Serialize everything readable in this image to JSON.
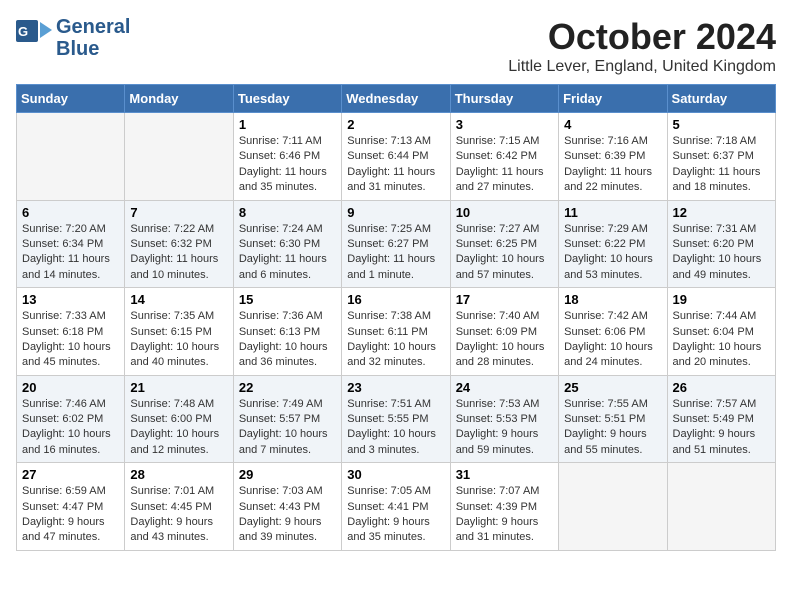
{
  "logo": {
    "line1": "General",
    "line2": "Blue"
  },
  "title": "October 2024",
  "location": "Little Lever, England, United Kingdom",
  "days_of_week": [
    "Sunday",
    "Monday",
    "Tuesday",
    "Wednesday",
    "Thursday",
    "Friday",
    "Saturday"
  ],
  "weeks": [
    [
      {
        "day": "",
        "info": ""
      },
      {
        "day": "",
        "info": ""
      },
      {
        "day": "1",
        "sunrise": "7:11 AM",
        "sunset": "6:46 PM",
        "daylight": "11 hours and 35 minutes."
      },
      {
        "day": "2",
        "sunrise": "7:13 AM",
        "sunset": "6:44 PM",
        "daylight": "11 hours and 31 minutes."
      },
      {
        "day": "3",
        "sunrise": "7:15 AM",
        "sunset": "6:42 PM",
        "daylight": "11 hours and 27 minutes."
      },
      {
        "day": "4",
        "sunrise": "7:16 AM",
        "sunset": "6:39 PM",
        "daylight": "11 hours and 22 minutes."
      },
      {
        "day": "5",
        "sunrise": "7:18 AM",
        "sunset": "6:37 PM",
        "daylight": "11 hours and 18 minutes."
      }
    ],
    [
      {
        "day": "6",
        "sunrise": "7:20 AM",
        "sunset": "6:34 PM",
        "daylight": "11 hours and 14 minutes."
      },
      {
        "day": "7",
        "sunrise": "7:22 AM",
        "sunset": "6:32 PM",
        "daylight": "11 hours and 10 minutes."
      },
      {
        "day": "8",
        "sunrise": "7:24 AM",
        "sunset": "6:30 PM",
        "daylight": "11 hours and 6 minutes."
      },
      {
        "day": "9",
        "sunrise": "7:25 AM",
        "sunset": "6:27 PM",
        "daylight": "11 hours and 1 minute."
      },
      {
        "day": "10",
        "sunrise": "7:27 AM",
        "sunset": "6:25 PM",
        "daylight": "10 hours and 57 minutes."
      },
      {
        "day": "11",
        "sunrise": "7:29 AM",
        "sunset": "6:22 PM",
        "daylight": "10 hours and 53 minutes."
      },
      {
        "day": "12",
        "sunrise": "7:31 AM",
        "sunset": "6:20 PM",
        "daylight": "10 hours and 49 minutes."
      }
    ],
    [
      {
        "day": "13",
        "sunrise": "7:33 AM",
        "sunset": "6:18 PM",
        "daylight": "10 hours and 45 minutes."
      },
      {
        "day": "14",
        "sunrise": "7:35 AM",
        "sunset": "6:15 PM",
        "daylight": "10 hours and 40 minutes."
      },
      {
        "day": "15",
        "sunrise": "7:36 AM",
        "sunset": "6:13 PM",
        "daylight": "10 hours and 36 minutes."
      },
      {
        "day": "16",
        "sunrise": "7:38 AM",
        "sunset": "6:11 PM",
        "daylight": "10 hours and 32 minutes."
      },
      {
        "day": "17",
        "sunrise": "7:40 AM",
        "sunset": "6:09 PM",
        "daylight": "10 hours and 28 minutes."
      },
      {
        "day": "18",
        "sunrise": "7:42 AM",
        "sunset": "6:06 PM",
        "daylight": "10 hours and 24 minutes."
      },
      {
        "day": "19",
        "sunrise": "7:44 AM",
        "sunset": "6:04 PM",
        "daylight": "10 hours and 20 minutes."
      }
    ],
    [
      {
        "day": "20",
        "sunrise": "7:46 AM",
        "sunset": "6:02 PM",
        "daylight": "10 hours and 16 minutes."
      },
      {
        "day": "21",
        "sunrise": "7:48 AM",
        "sunset": "6:00 PM",
        "daylight": "10 hours and 12 minutes."
      },
      {
        "day": "22",
        "sunrise": "7:49 AM",
        "sunset": "5:57 PM",
        "daylight": "10 hours and 7 minutes."
      },
      {
        "day": "23",
        "sunrise": "7:51 AM",
        "sunset": "5:55 PM",
        "daylight": "10 hours and 3 minutes."
      },
      {
        "day": "24",
        "sunrise": "7:53 AM",
        "sunset": "5:53 PM",
        "daylight": "9 hours and 59 minutes."
      },
      {
        "day": "25",
        "sunrise": "7:55 AM",
        "sunset": "5:51 PM",
        "daylight": "9 hours and 55 minutes."
      },
      {
        "day": "26",
        "sunrise": "7:57 AM",
        "sunset": "5:49 PM",
        "daylight": "9 hours and 51 minutes."
      }
    ],
    [
      {
        "day": "27",
        "sunrise": "6:59 AM",
        "sunset": "4:47 PM",
        "daylight": "9 hours and 47 minutes."
      },
      {
        "day": "28",
        "sunrise": "7:01 AM",
        "sunset": "4:45 PM",
        "daylight": "9 hours and 43 minutes."
      },
      {
        "day": "29",
        "sunrise": "7:03 AM",
        "sunset": "4:43 PM",
        "daylight": "9 hours and 39 minutes."
      },
      {
        "day": "30",
        "sunrise": "7:05 AM",
        "sunset": "4:41 PM",
        "daylight": "9 hours and 35 minutes."
      },
      {
        "day": "31",
        "sunrise": "7:07 AM",
        "sunset": "4:39 PM",
        "daylight": "9 hours and 31 minutes."
      },
      {
        "day": "",
        "info": ""
      },
      {
        "day": "",
        "info": ""
      }
    ]
  ],
  "labels": {
    "sunrise": "Sunrise:",
    "sunset": "Sunset:",
    "daylight": "Daylight:"
  }
}
